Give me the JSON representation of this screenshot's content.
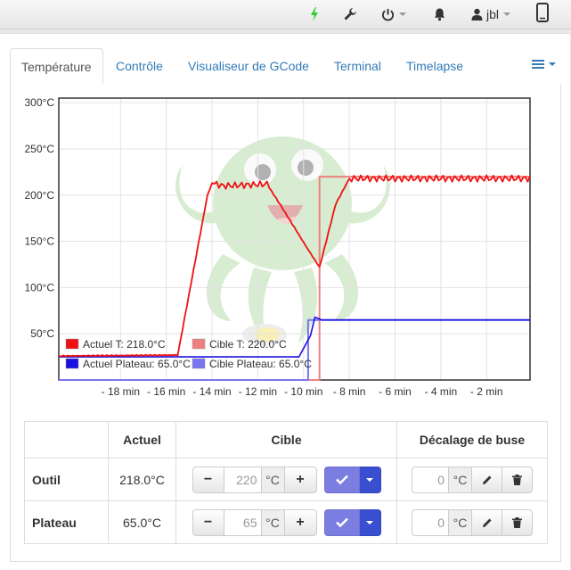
{
  "navbar": {
    "user_name": "jbl"
  },
  "tabs": [
    "Température",
    "Contrôle",
    "Visualiseur de GCode",
    "Terminal",
    "Timelapse"
  ],
  "active_tab": 0,
  "chart_data": {
    "type": "line",
    "y_ticks": [
      "300°C",
      "250°C",
      "200°C",
      "150°C",
      "100°C",
      "50°C"
    ],
    "x_ticks": [
      "- 18 min",
      "- 16 min",
      "- 14 min",
      "- 12 min",
      "- 10 min",
      "- 8 min",
      "- 6 min",
      "- 4 min",
      "- 2 min"
    ],
    "ylim": [
      0,
      305
    ],
    "xlim": [
      -20.7,
      -0.1
    ],
    "grid": true,
    "legend_position": "bottom-left",
    "series": [
      {
        "name": "Actuel T: 218.0°C",
        "color": "#ee1111",
        "x": [
          -20.7,
          -15.5,
          -14.2,
          -14.0,
          -13.5,
          -11.6,
          -10.9,
          -9.9,
          -9.3,
          -8.6,
          -8.0,
          -0.1
        ],
        "y": [
          26,
          27,
          200,
          213,
          210,
          212,
          185,
          145,
          122,
          190,
          218,
          218
        ]
      },
      {
        "name": "Cible T: 220.0°C",
        "color": "#f08080",
        "x": [
          -20.7,
          -9.3,
          -9.3,
          -0.1
        ],
        "y": [
          0,
          0,
          220,
          220
        ]
      },
      {
        "name": "Actuel Plateau: 65.0°C",
        "color": "#1a10e0",
        "x": [
          -20.7,
          -10.2,
          -9.7,
          -9.5,
          -9.2,
          -0.1
        ],
        "y": [
          25,
          25,
          48,
          68,
          65,
          65
        ]
      },
      {
        "name": "Cible Plateau: 65.0°C",
        "color": "#7b74f0",
        "x": [
          -20.7,
          -9.8,
          -9.8,
          -0.1
        ],
        "y": [
          0,
          0,
          65,
          65
        ]
      }
    ]
  },
  "table": {
    "headers": [
      "",
      "Actuel",
      "Cible",
      "Décalage de buse"
    ],
    "unit": "°C",
    "rows": [
      {
        "name": "Outil",
        "actual": "218.0°C",
        "target": "220",
        "offset": "0"
      },
      {
        "name": "Plateau",
        "actual": "65.0°C",
        "target": "65",
        "offset": "0"
      }
    ]
  },
  "colors": {
    "accent": "#337ab7",
    "set_button": "#7b7de0",
    "dropdown_button": "#3a4fcf"
  }
}
